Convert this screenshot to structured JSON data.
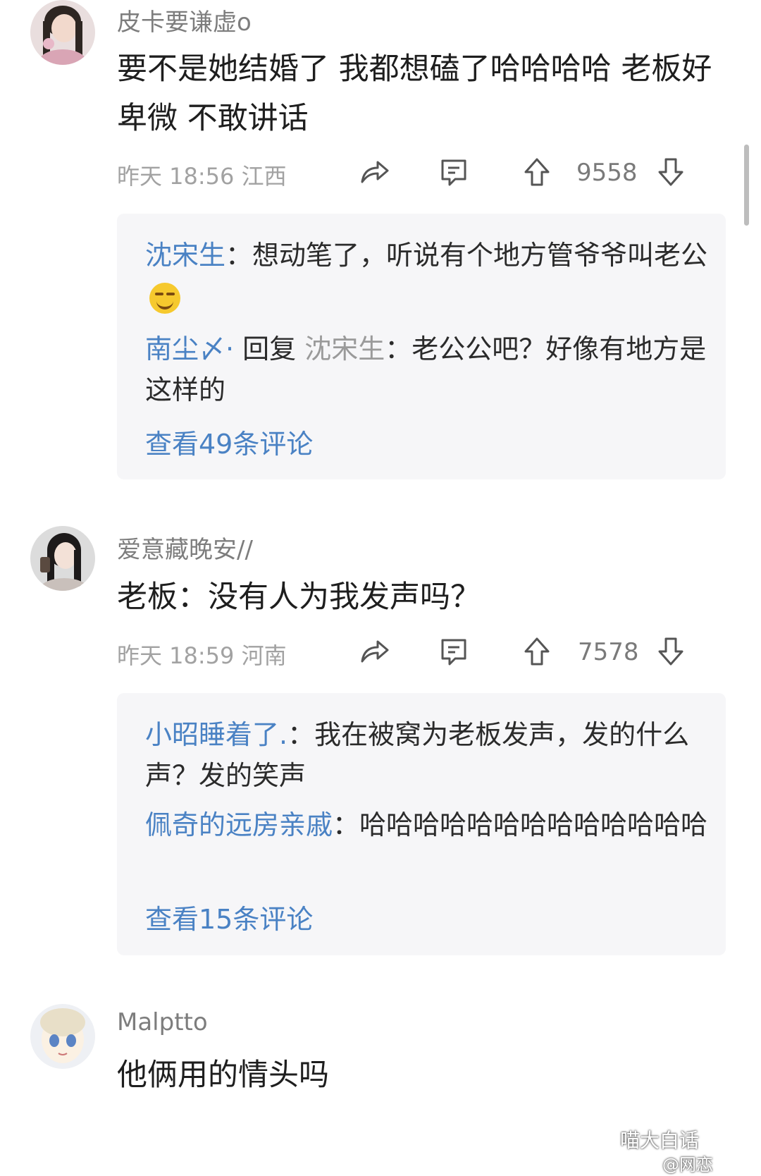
{
  "comments": [
    {
      "username": "皮卡要谦虚o",
      "text": "要不是她结婚了  我都想磕了哈哈哈哈 老板好卑微 不敢讲话",
      "time": "昨天 18:56",
      "location": "江西",
      "likes": "9558",
      "replies": [
        {
          "author": "沈宋生",
          "sep": "：",
          "text": "想动笔了，听说有个地方管爷爷叫老公",
          "emoji": "laughing-emoji"
        },
        {
          "author": "南尘〆·",
          "reply_word": " 回复 ",
          "reply_to": "沈宋生",
          "sep": "：",
          "text": "老公公吧？好像有地方是这样的"
        }
      ],
      "view_more": "查看49条评论"
    },
    {
      "username": "爱意藏晚安//",
      "text": "老板：没有人为我发声吗？",
      "time": "昨天 18:59",
      "location": "河南",
      "likes": "7578",
      "replies": [
        {
          "author": "小昭睡着了.",
          "sep": "：",
          "text": "我在被窝为老板发声，发的什么声？发的笑声"
        },
        {
          "author": "佩奇的远房亲戚",
          "sep": "：",
          "text": "哈哈哈哈哈哈哈哈哈哈哈哈哈"
        }
      ],
      "view_more": "查看15条评论"
    },
    {
      "username": "Malptto",
      "text": "他俩用的情头吗"
    }
  ],
  "watermark": {
    "line1": "喵大白话",
    "line2": "@网恋"
  },
  "colors": {
    "link_blue": "#4a82c4",
    "reply_bg": "#f6f6f8",
    "meta_grey": "#a2a2a2"
  }
}
